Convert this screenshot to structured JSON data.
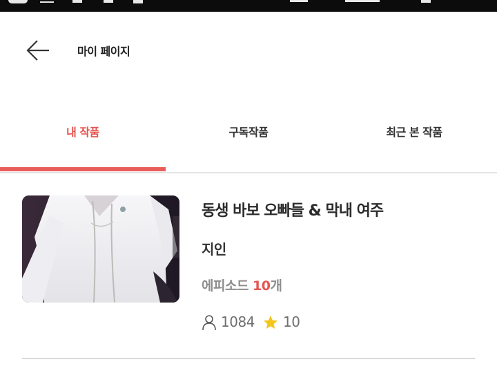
{
  "status_bar": {
    "left_icons": [
      "app-icon",
      "menu-icon",
      "notification-icon",
      "notification-icon",
      "notification-icon"
    ],
    "right_icons": [
      "wifi-icon",
      "signal-icon",
      "battery-icon"
    ]
  },
  "header": {
    "title": "마이 페이지",
    "back_icon": "back-arrow-icon"
  },
  "tabs": [
    {
      "label": "내 작품",
      "active": true
    },
    {
      "label": "구독작품",
      "active": false
    },
    {
      "label": "최근 본 작품",
      "active": false
    }
  ],
  "colors": {
    "accent": "#e85d5a",
    "text_dark": "#2b2b2b",
    "text_muted": "#8d8d8d",
    "star": "#f5c518"
  },
  "works": [
    {
      "title": "동생 바보 오빠들 & 막내 여주",
      "author": "지인",
      "episode_prefix": "에피소드 ",
      "episode_count": "10",
      "episode_suffix": "개",
      "views": "1084",
      "rating": "10",
      "views_icon": "user-icon",
      "rating_icon": "star-icon"
    }
  ]
}
